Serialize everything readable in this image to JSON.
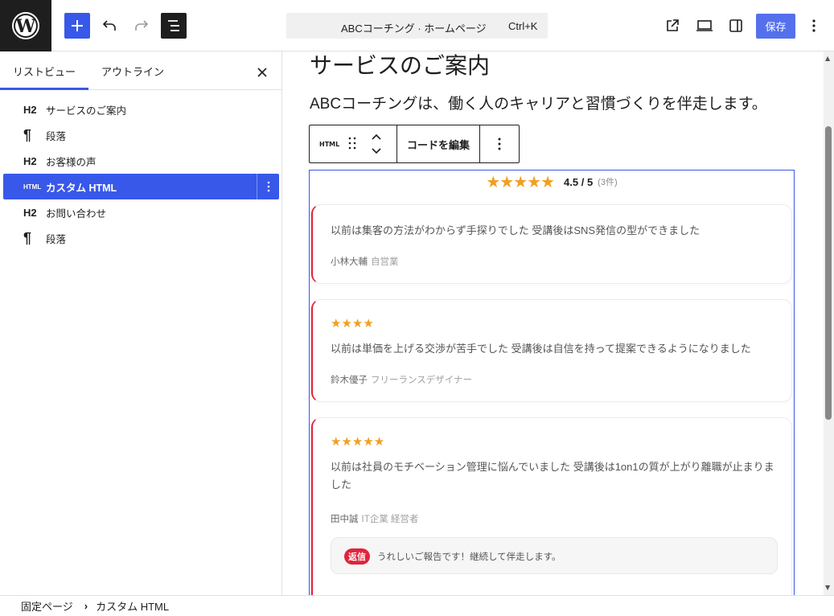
{
  "topbar": {
    "command_title": "ABCコーチング · ホームページ",
    "command_shortcut": "Ctrl+K",
    "save_label": "保存"
  },
  "sidebar": {
    "tabs": [
      {
        "label": "リストビュー",
        "active": true
      },
      {
        "label": "アウトライン",
        "active": false
      }
    ],
    "tree": [
      {
        "icon": "H2",
        "label": "サービスのご案内",
        "selected": false
      },
      {
        "icon": "¶",
        "label": "段落",
        "selected": false
      },
      {
        "icon": "H2",
        "label": "お客様の声",
        "selected": false
      },
      {
        "icon": "HTML",
        "label": "カスタム HTML",
        "selected": true
      },
      {
        "icon": "H2",
        "label": "お問い合わせ",
        "selected": false
      },
      {
        "icon": "¶",
        "label": "段落",
        "selected": false
      }
    ]
  },
  "canvas": {
    "heading": "サービスのご案内",
    "paragraph": "ABCコーチングは、働く人のキャリアと習慣づくりを伴走します。",
    "block_toolbar": {
      "type_label": "HTML",
      "edit_label": "コードを編集"
    },
    "reviews_widget": {
      "summary_stars": "★★★★★",
      "summary_score": "4.5 / 5",
      "summary_count": "(3件)",
      "reviews": [
        {
          "stars": "",
          "text": "以前は集客の方法がわからず手探りでした 受講後はSNS発信の型ができました",
          "author": "小林大輔",
          "role": "自営業"
        },
        {
          "stars": "★★★★",
          "text": "以前は単価を上げる交渉が苦手でした 受講後は自信を持って提案できるようになりました",
          "author": "鈴木優子",
          "role": "フリーランスデザイナー"
        },
        {
          "stars": "★★★★★",
          "text": "以前は社員のモチベーション管理に悩んでいました 受講後は1on1の質が上がり離職が止まりました",
          "author": "田中誠",
          "role": "IT企業 経営者",
          "reply_badge": "返信",
          "reply_text": "うれしいご報告です！継続して伴走します。"
        }
      ]
    }
  },
  "footer": {
    "breadcrumb_root": "固定ページ",
    "breadcrumb_separator": "›",
    "breadcrumb_current": "カスタム HTML"
  },
  "colors": {
    "accent": "#3858e9",
    "star": "#f0a020",
    "review_border": "#e0243d",
    "topbar_logo_bg": "#1e1e1e"
  }
}
